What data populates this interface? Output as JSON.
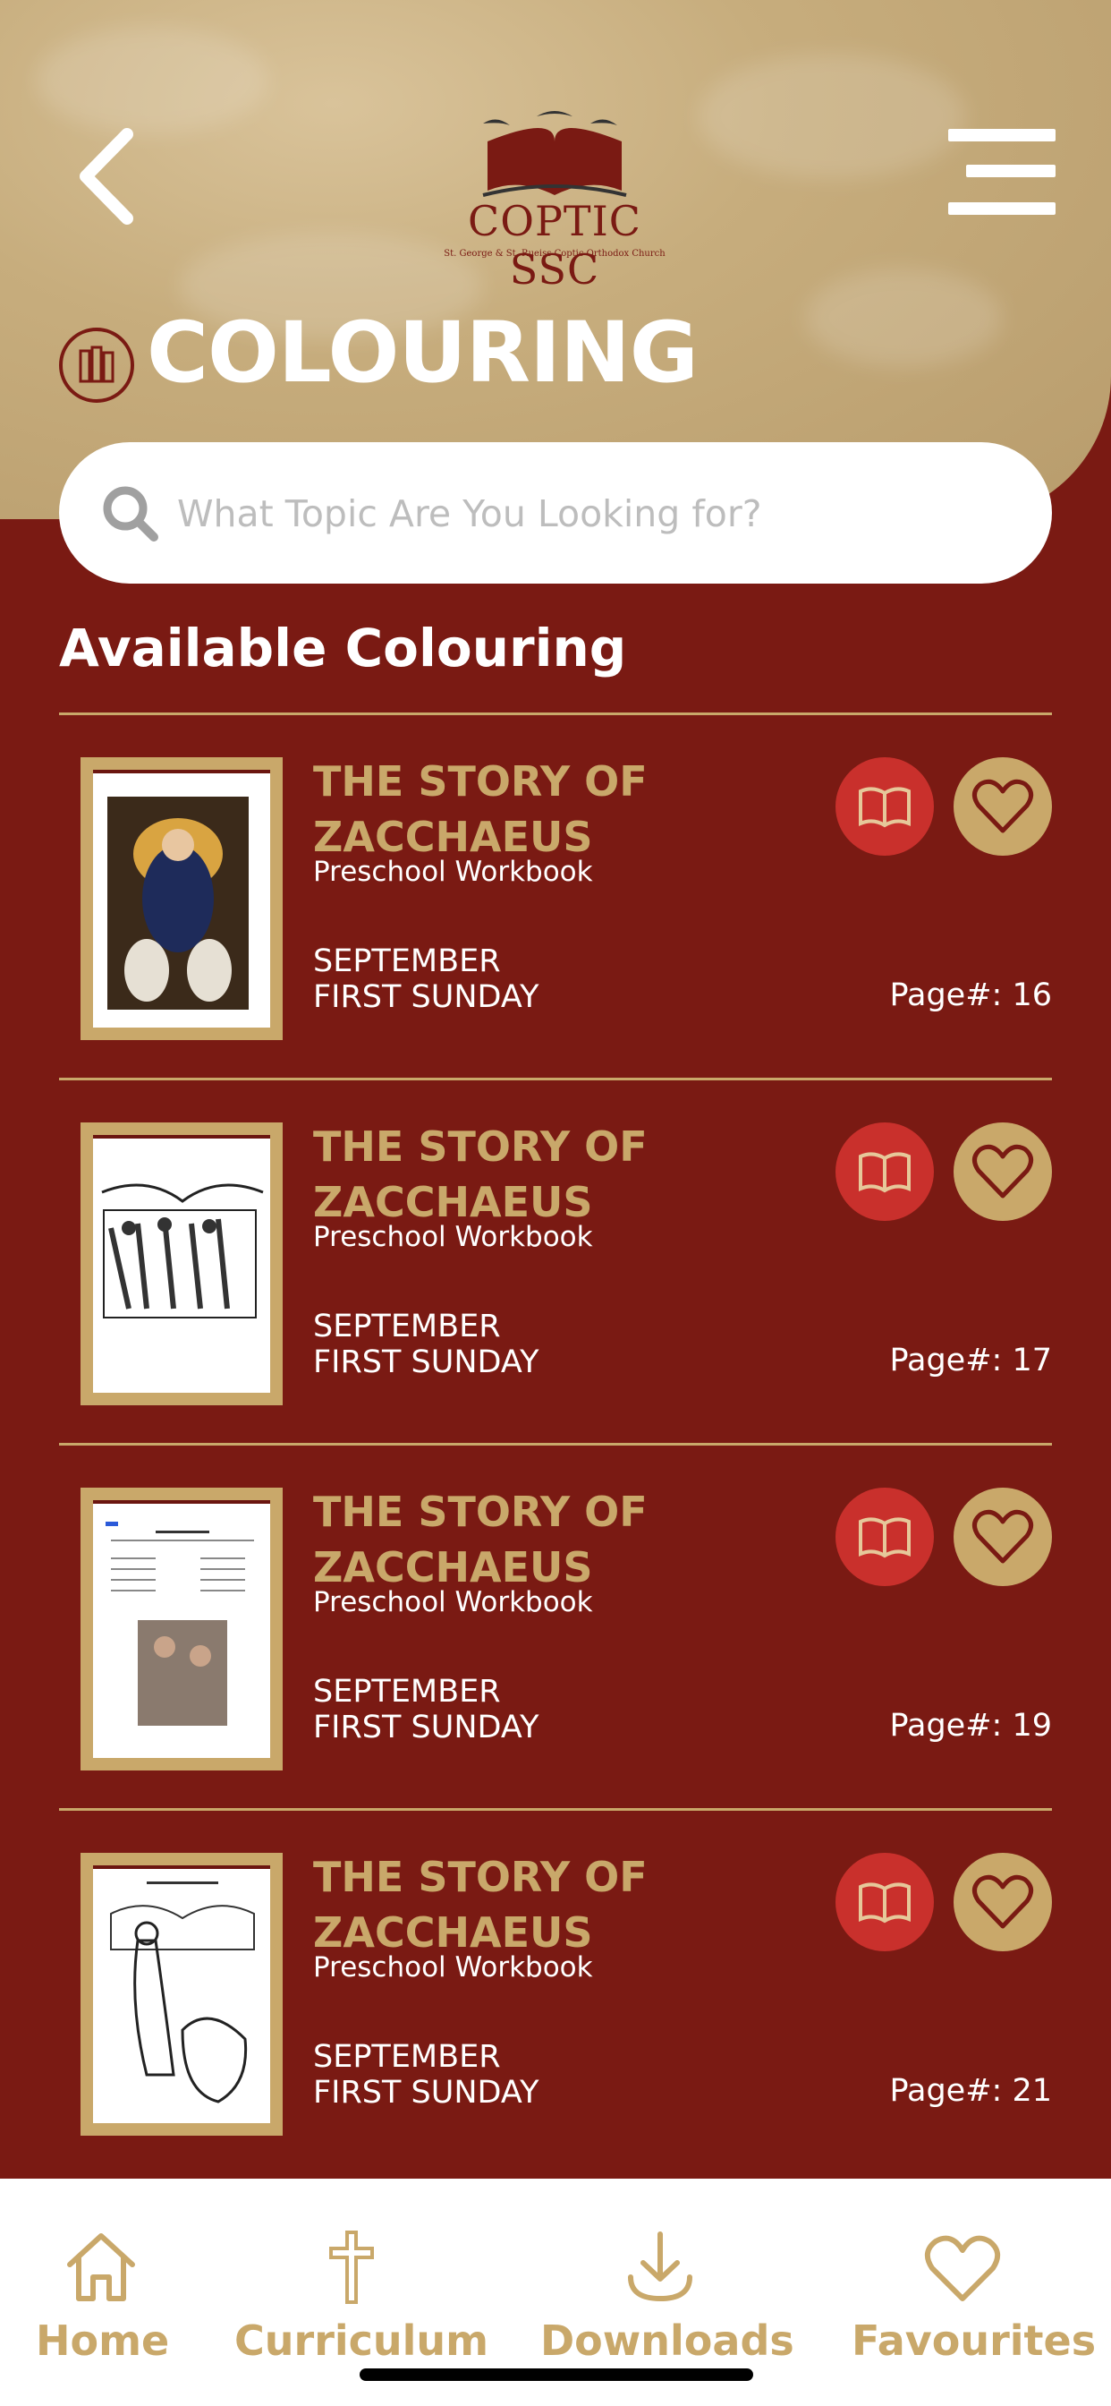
{
  "header": {
    "logo_title": "COPTIC  SSC",
    "logo_subtitle": "St. George & St. Rueiss Coptic Orthodox Church",
    "page_title": "COLOURING"
  },
  "search": {
    "placeholder": "What Topic Are You Looking for?"
  },
  "section_title": "Available Colouring",
  "items": [
    {
      "title": "THE STORY OF ZACCHAEUS",
      "subtitle": "Preschool Workbook",
      "month": "SEPTEMBER",
      "week": "FIRST SUNDAY",
      "page": "Page#: 16"
    },
    {
      "title": "THE STORY OF ZACCHAEUS",
      "subtitle": "Preschool Workbook",
      "month": "SEPTEMBER",
      "week": "FIRST SUNDAY",
      "page": "Page#: 17"
    },
    {
      "title": "THE STORY OF ZACCHAEUS",
      "subtitle": "Preschool Workbook",
      "month": "SEPTEMBER",
      "week": "FIRST SUNDAY",
      "page": "Page#: 19"
    },
    {
      "title": "THE STORY OF ZACCHAEUS",
      "subtitle": "Preschool Workbook",
      "month": "SEPTEMBER",
      "week": "FIRST SUNDAY",
      "page": "Page#: 21"
    }
  ],
  "tabs": [
    {
      "label": "Home",
      "icon": "home-icon"
    },
    {
      "label": "Curriculum",
      "icon": "cross-icon"
    },
    {
      "label": "Downloads",
      "icon": "download-icon"
    },
    {
      "label": "Favourites",
      "icon": "heart-icon"
    }
  ],
  "colors": {
    "primary": "#7a1a13",
    "gold": "#c9a86a",
    "accent_red": "#c9302c"
  }
}
